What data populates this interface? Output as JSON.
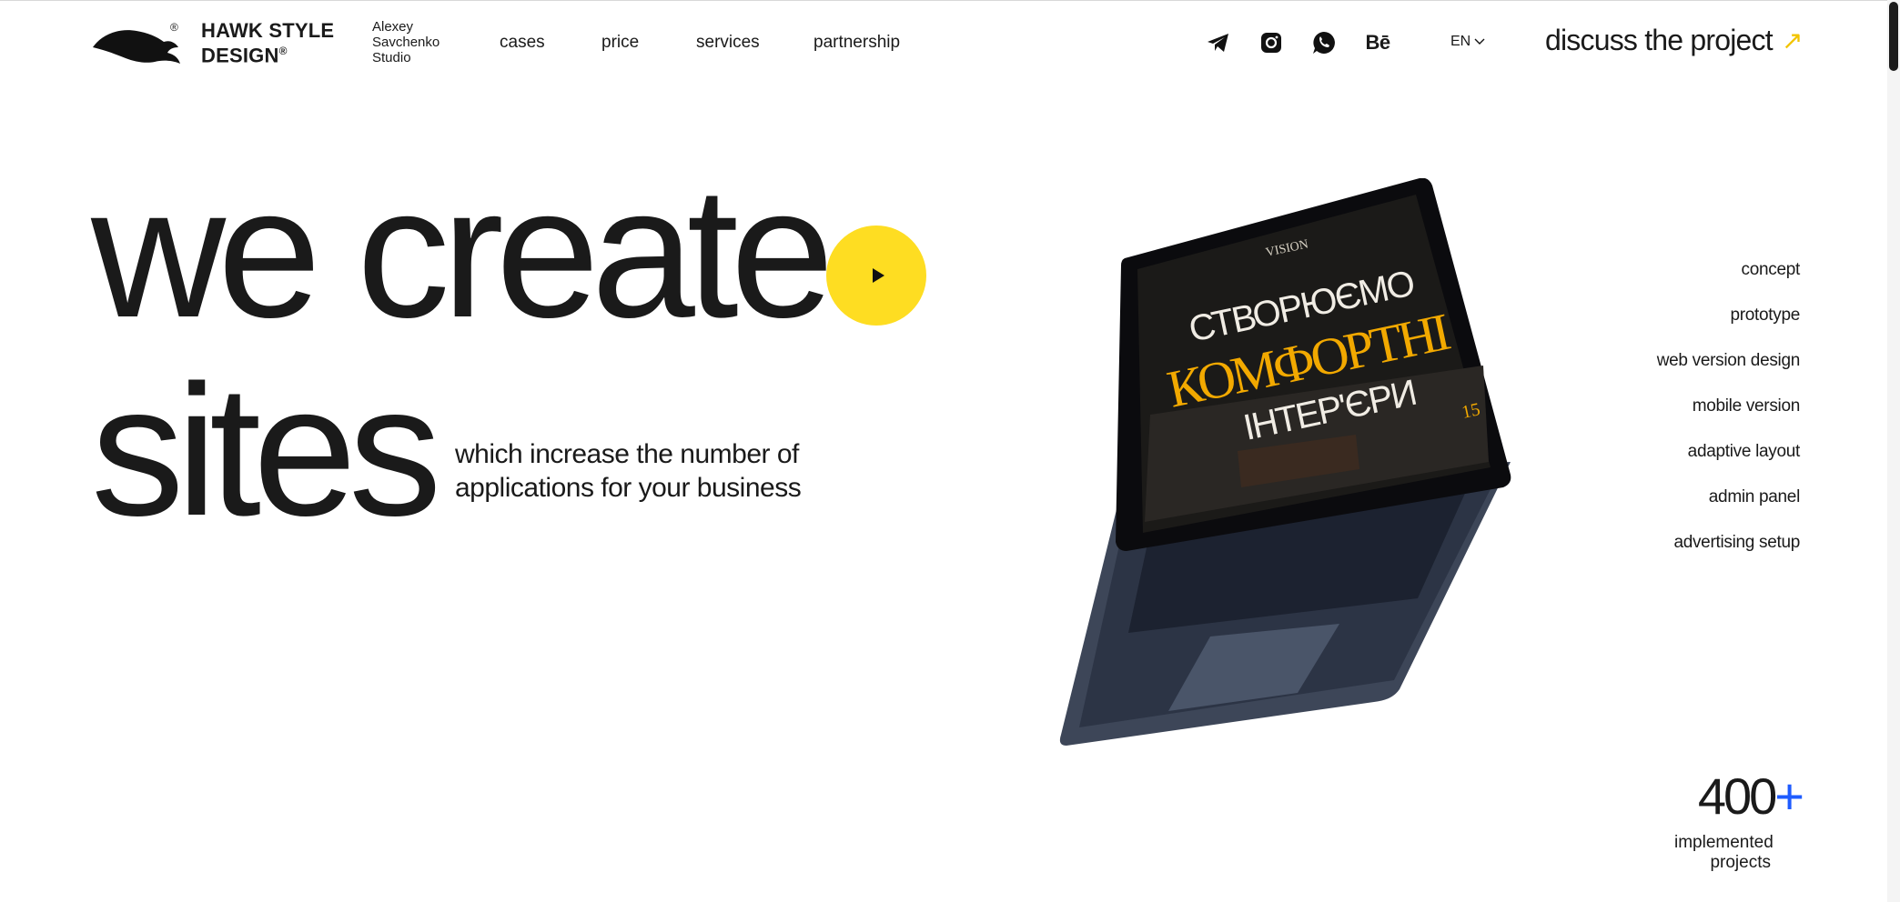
{
  "header": {
    "brand_line1": "HAWK STYLE",
    "brand_line2": "DESIGN",
    "registered_mark": "®",
    "studio_line1": "Alexey",
    "studio_line2": "Savchenko",
    "studio_line3": "Studio",
    "nav": [
      "cases",
      "price",
      "services",
      "partnership"
    ],
    "social_icons": [
      "telegram-icon",
      "instagram-icon",
      "whatsapp-icon",
      "behance-icon"
    ],
    "behance_label": "Bē",
    "language": "EN",
    "cta_label": "discuss the project",
    "cta_arrow": "↗"
  },
  "hero": {
    "line1": "we create",
    "line2": "sites",
    "subtitle_line1": "which increase the number of",
    "subtitle_line2": "applications for your business"
  },
  "laptop_screen": {
    "brand": "VISION",
    "headline1": "СТВОРЮЄМО",
    "headline2": "КОМФОРТНІ",
    "headline3": "ІНТЕР'ЄРИ",
    "badge": "15"
  },
  "services_list": [
    "concept",
    "prototype",
    "web version design",
    "mobile version",
    "adaptive layout",
    "admin panel",
    "advertising setup"
  ],
  "stats": {
    "count": "400",
    "plus": "+",
    "label_line1": "implemented",
    "label_line2": "projects"
  },
  "colors": {
    "accent_yellow": "#fedd22",
    "accent_blue": "#1f5cff",
    "text": "#1a1a1a"
  }
}
